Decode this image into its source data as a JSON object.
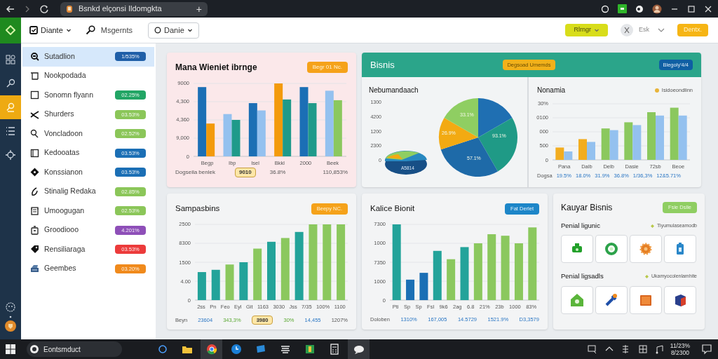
{
  "browser": {
    "tab_title": "Bsnkd elçonsi Ildomgkta",
    "new_tab": "+"
  },
  "header": {
    "menu": "Diante",
    "search": "Msgernts",
    "select": "Danie",
    "yellow_button": "Rlrngr",
    "user": "Esk",
    "orange_button": "Dentx."
  },
  "rail": [
    {
      "selected": false
    },
    {
      "selected": false
    },
    {
      "selected": true
    },
    {
      "selected": false
    },
    {
      "selected": false
    }
  ],
  "sidebar": {
    "items": [
      {
        "label": "Sutadlion",
        "badge": "1/535%",
        "color": "#1f5fa8",
        "selected": true
      },
      {
        "label": "Nookpodada",
        "selected": false
      },
      {
        "label": "Sonomn flyann",
        "badge": "02.25%",
        "color": "#22a565",
        "selected": false
      },
      {
        "label": "Shurders",
        "badge": "03.53%",
        "color": "#8bc659",
        "selected": false
      },
      {
        "label": "Voncladoon",
        "badge": "02.52%",
        "color": "#8bc659",
        "selected": false
      },
      {
        "label": "Kedooatas",
        "badge": "03.53%",
        "color": "#1b6fb5",
        "selected": false
      },
      {
        "label": "Konssianon",
        "badge": "03.53%",
        "color": "#1b6fb5",
        "selected": false
      },
      {
        "label": "Stinalig Redaka",
        "badge": "02.85%",
        "color": "#8bc659",
        "selected": false
      },
      {
        "label": "Umoogugan",
        "badge": "02.53%",
        "color": "#8bc659",
        "selected": false
      },
      {
        "label": "Groodiooo",
        "badge": "4.201%",
        "color": "#8e4fb8",
        "selected": false
      },
      {
        "label": "Rensiliaraga",
        "badge": "03.53%",
        "color": "#ec3b3b",
        "selected": false
      },
      {
        "label": "Geembes",
        "badge": "03.20%",
        "color": "#f08a1c",
        "selected": false
      }
    ]
  },
  "cards": {
    "revenue": {
      "title": "Mana Wieniet ibrnge",
      "button": "Begr 01 Nc.",
      "yticks": [
        "9000",
        "4,300",
        "4,360",
        "9,000",
        "0"
      ],
      "xlabels": [
        "Begp",
        "Ibp",
        "Isel",
        "Bkkl",
        "2000",
        "Beek"
      ],
      "footer": [
        "Dogseila benlek",
        "9010",
        "36.8%",
        "110,853%"
      ]
    },
    "business": {
      "title": "Bisnis",
      "button": "Degsoad Umemds",
      "button_2": "Blegoly'4/4",
      "pie_panel": {
        "title": "Nebumandaach",
        "yticks": [
          "1300",
          "4200",
          "1200",
          "2300",
          "0"
        ],
        "slice_labels": [
          "33.1%",
          "26.9%",
          "93.1%",
          "57.1%"
        ],
        "small_label": "A5814"
      },
      "bar_panel": {
        "title": "Nonamia",
        "legend": "Isidoeondlinn",
        "yticks": [
          "30%",
          "0100",
          "000",
          "500",
          "0"
        ],
        "xlabels": [
          "Pana",
          "Dalb",
          "Delb",
          "Dasie",
          "72sb",
          "Beoe"
        ],
        "footer": [
          "Dogsa",
          "19.5%",
          "18.0%",
          "31.9%",
          "36.8%",
          "1/36,3%",
          "12&5.71%"
        ]
      }
    },
    "samples": {
      "title": "Sampasbins",
      "button": "Beepy NC.",
      "yticks": [
        "2500",
        "8300",
        "1500",
        "4.00",
        "0"
      ],
      "xlabels": [
        "2ss",
        "Pn",
        "Feo",
        "Eyl",
        "Git",
        "1163",
        "3030",
        "Jss",
        "7/35",
        "100%",
        "1100"
      ],
      "footer": [
        "Beyn",
        "23604",
        "343,3%",
        "3980",
        "30%",
        "14,455",
        "1207%"
      ]
    },
    "kalice": {
      "title": "Kalice Bionit",
      "button": "Fat Derlet",
      "yticks": [
        "7300",
        "1000",
        "7350",
        "1000",
        "0"
      ],
      "xlabels": [
        "Pti",
        "Sp",
        "Sp",
        "Fsl",
        "9k6",
        "2ag",
        "6.8",
        "21%",
        "23b",
        "1000",
        "83%"
      ],
      "footer": [
        "Doloben",
        "1310%",
        "167,005",
        "14.5729",
        "1521.9%",
        "D3,3579"
      ]
    },
    "kauyar": {
      "title": "Kauyar Bisnis",
      "button": "Fsie Dslie",
      "sections": [
        {
          "title": "Penial ligunic",
          "legend": "Tiyumulaseamodb"
        },
        {
          "title": "Penial ligsadls",
          "legend": "Ukamyocolenlamhite"
        }
      ]
    }
  },
  "taskbar": {
    "search": "Eontsmduct",
    "time": "11/23%",
    "date": "8/2300"
  }
}
